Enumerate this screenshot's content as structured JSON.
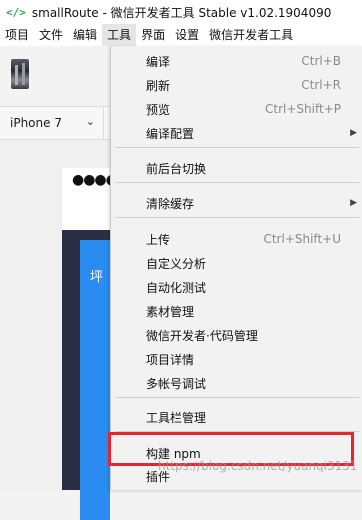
{
  "window": {
    "title": "smallRoute - 微信开发者工具 Stable v1.02.1904090",
    "app_icon": "</>"
  },
  "menubar": {
    "items": [
      "项目",
      "文件",
      "编辑",
      "工具",
      "界面",
      "设置",
      "微信开发者工具"
    ]
  },
  "device": {
    "selected": "iPhone 7",
    "chevron": "⌄"
  },
  "simulator": {
    "status_dots": "●●●●●",
    "blue_text": "坪"
  },
  "tools_menu": {
    "items": [
      {
        "label": "编译",
        "shortcut": "Ctrl+B"
      },
      {
        "label": "刷新",
        "shortcut": "Ctrl+R"
      },
      {
        "label": "预览",
        "shortcut": "Ctrl+Shift+P"
      },
      {
        "label": "编译配置",
        "shortcut": "",
        "submenu": true
      },
      {
        "label": "前后台切换",
        "shortcut": ""
      },
      {
        "label": "清除缓存",
        "shortcut": "",
        "submenu": true
      },
      {
        "label": "上传",
        "shortcut": "Ctrl+Shift+U"
      },
      {
        "label": "自定义分析",
        "shortcut": ""
      },
      {
        "label": "自动化测试",
        "shortcut": ""
      },
      {
        "label": "素材管理",
        "shortcut": ""
      },
      {
        "label": "微信开发者·代码管理",
        "shortcut": ""
      },
      {
        "label": "项目详情",
        "shortcut": ""
      },
      {
        "label": "多帐号调试",
        "shortcut": ""
      },
      {
        "label": "工具栏管理",
        "shortcut": ""
      },
      {
        "label": "构建 npm",
        "shortcut": ""
      },
      {
        "label": "插件",
        "shortcut": ""
      }
    ],
    "submenu_arrow": "▶"
  },
  "watermark": "https://blog.csdn.net/yuanqi3131",
  "colors": {
    "highlight_border": "#e8242f",
    "sim_blue": "#2a8cf0",
    "sim_dark": "#2b2f45"
  }
}
